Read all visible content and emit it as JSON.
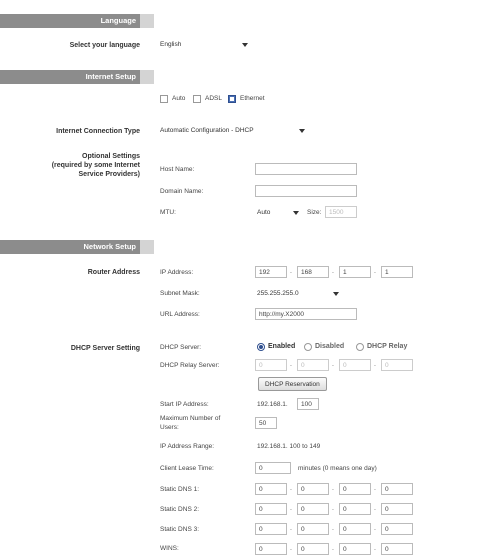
{
  "language": {
    "section_title": "Language",
    "label": "Select your language",
    "selected": "English"
  },
  "internet": {
    "section_title": "Internet Setup",
    "types": [
      {
        "label": "Auto",
        "checked": false
      },
      {
        "label": "ADSL",
        "checked": false
      },
      {
        "label": "Ethernet",
        "checked": true
      }
    ],
    "connection_type_label": "Internet Connection Type",
    "connection_type_value": "Automatic Configuration - DHCP",
    "optional_label_1": "Optional Settings",
    "optional_label_2": "(required by some Internet",
    "optional_label_3": "Service Providers)",
    "host_name_label": "Host Name:",
    "host_name_value": "",
    "domain_name_label": "Domain Name:",
    "domain_name_value": "",
    "mtu_label": "MTU:",
    "mtu_value": "Auto",
    "size_label": "Size:",
    "size_value": "1500"
  },
  "network": {
    "section_title": "Network Setup",
    "router_address_label": "Router Address",
    "ip_label": "IP Address:",
    "ip": [
      "192",
      "168",
      "1",
      "1"
    ],
    "subnet_label": "Subnet Mask:",
    "subnet_value": "255.255.255.0",
    "url_label": "URL Address:",
    "url_value": "http://my.X2000",
    "dhcp_setting_label": "DHCP Server Setting",
    "dhcp_server_label": "DHCP Server:",
    "dhcp_options": [
      {
        "label": "Enabled",
        "selected": true
      },
      {
        "label": "Disabled",
        "selected": false
      },
      {
        "label": "DHCP Relay",
        "selected": false
      }
    ],
    "relay_label": "DHCP Relay Server:",
    "relay": [
      "0",
      "0",
      "0",
      "0"
    ],
    "reservation_button": "DHCP Reservation",
    "start_ip_label": "Start IP Address:",
    "start_ip_prefix": "192.168.1.",
    "start_ip_value": "100",
    "max_users_label_1": "Maximum Number of",
    "max_users_label_2": "Users:",
    "max_users_value": "50",
    "ip_range_label": "IP Address Range:",
    "ip_range_value": "192.168.1. 100 to 149",
    "lease_label": "Client Lease Time:",
    "lease_value": "0",
    "lease_suffix": "minutes (0 means one day)",
    "dns1_label": "Static DNS 1:",
    "dns1": [
      "0",
      "0",
      "0",
      "0"
    ],
    "dns2_label": "Static DNS 2:",
    "dns2": [
      "0",
      "0",
      "0",
      "0"
    ],
    "dns3_label": "Static DNS 3:",
    "dns3": [
      "0",
      "0",
      "0",
      "0"
    ],
    "wins_label": "WINS:",
    "wins": [
      "0",
      "0",
      "0",
      "0"
    ]
  }
}
